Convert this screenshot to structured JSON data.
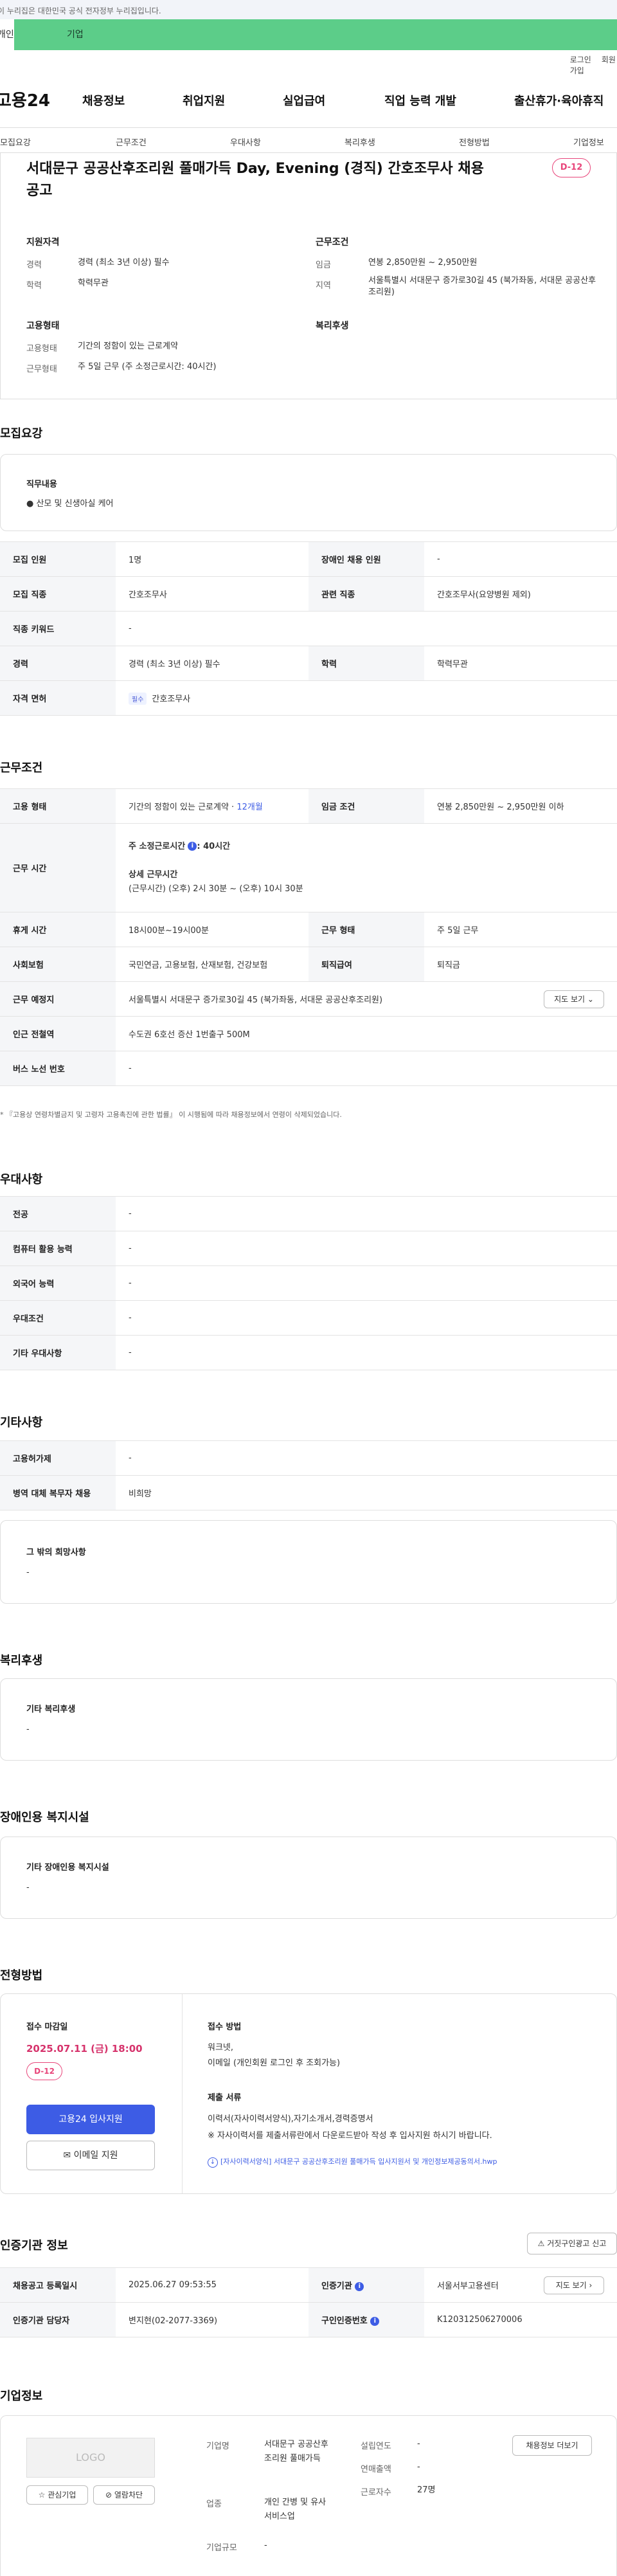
{
  "gov_banner": "이 누리집은 대한민국 공식 전자정부 누리집입니다.",
  "top_tabs": {
    "personal": "개인",
    "company": "기업"
  },
  "util": {
    "login": "로그인",
    "signup": "회원가입"
  },
  "gnb": {
    "logo": "고용24",
    "items": [
      "채용정보",
      "취업지원",
      "실업급여",
      "직업 능력 개발",
      "출산휴가·육아휴직"
    ]
  },
  "subnav": [
    "모집요강",
    "근무조건",
    "우대사항",
    "복리후생",
    "전형방법",
    "기업정보"
  ],
  "header": {
    "title": "서대문구 공공산후조리원 풀매가득 Day, Evening (경직) 간호조무사 채용 공고",
    "dday": "D-12",
    "qual": {
      "heading": "지원자격",
      "rows": [
        {
          "k": "경력",
          "v": "경력 (최소 3년 이상) 필수"
        },
        {
          "k": "학력",
          "v": "학력무관"
        }
      ]
    },
    "cond": {
      "heading": "근무조건",
      "rows": [
        {
          "k": "임금",
          "v": "연봉 2,850만원 ~ 2,950만원"
        },
        {
          "k": "지역",
          "v": "서울특별시 서대문구 증가로30길 45 (북가좌동, 서대문 공공산후조리원)"
        }
      ]
    },
    "emp": {
      "heading": "고용형태",
      "rows": [
        {
          "k": "고용형태",
          "v": "기간의 정함이 있는 근로계약"
        },
        {
          "k": "근무형태",
          "v": "주 5일 근무 (주 소정근로시간: 40시간)"
        }
      ]
    },
    "welfare": {
      "heading": "복리후생"
    }
  },
  "recruit": {
    "title": "모집요강",
    "duty_label": "직무내용",
    "duty": "● 산모 및 신생아실 케어",
    "rows": [
      {
        "k1": "모집 인원",
        "v1": "1명",
        "k2": "장애인 채용 인원",
        "v2": "-"
      },
      {
        "k1": "모집 직종",
        "v1": "간호조무사",
        "k2": "관련 직종",
        "v2": "간호조무사(요양병원 제외)"
      },
      {
        "k1": "직종 키워드",
        "v1": "-"
      },
      {
        "k1": "경력",
        "v1": "경력 (최소 3년 이상) 필수",
        "k2": "학력",
        "v2": "학력무관"
      },
      {
        "k1": "자격 면허",
        "badge": "필수",
        "v1": "간호조무사"
      }
    ]
  },
  "work": {
    "title": "근무조건",
    "emp_k": "고용 형태",
    "emp_v": "기간의 정함이 있는 근로계약 · ",
    "emp_v2": "12개월",
    "wage_k": "임금 조건",
    "wage_v": "연봉 2,850만원 ~ 2,950만원 이하",
    "time_k": "근무 시간",
    "time_week": "주 소정근로시간",
    "time_week_v": ": 40시간",
    "time_detail_h": "상세 근무시간",
    "time_detail": "(근무시간) (오후) 2시 30분 ~ (오후) 10시 30분",
    "rest_k": "휴게 시간",
    "rest_v": "18시00분~19시00분",
    "form_k": "근무 형태",
    "form_v": "주 5일 근무",
    "ins_k": "사회보험",
    "ins_v": "국민연금, 고용보험, 산재보험, 건강보험",
    "ret_k": "퇴직급여",
    "ret_v": "퇴직금",
    "place_k": "근무 예정지",
    "place_v": "서울특별시 서대문구 증가로30길 45 (북가좌동, 서대문 공공산후조리원)",
    "map_btn": "지도 보기",
    "subway_k": "인근 전철역",
    "subway_v": "수도권 6호선 증산 1번출구 500M",
    "bus_k": "버스 노선 번호",
    "bus_v": "-",
    "note": "* 『고용상 연령차별금지 및 고령자 고용촉진에 관한 법률』 이 시행됨에 따라 채용정보에서 연령이 삭제되었습니다."
  },
  "pref": {
    "title": "우대사항",
    "rows": [
      {
        "k": "전공",
        "v": "-"
      },
      {
        "k": "컴퓨터 활용 능력",
        "v": "-"
      },
      {
        "k": "외국어 능력",
        "v": "-"
      },
      {
        "k": "우대조건",
        "v": "-"
      },
      {
        "k": "기타 우대사항",
        "v": "-"
      }
    ]
  },
  "etc": {
    "title": "기타사항",
    "rows": [
      {
        "k": "고용허가제",
        "v": "-"
      },
      {
        "k": "병역 대체 복무자 채용",
        "v": "비희망"
      }
    ],
    "hope_h": "그 밖의 희망사항",
    "hope_v": "-"
  },
  "benefit": {
    "title": "복리후생",
    "h": "기타 복리후생",
    "v": "-"
  },
  "facility": {
    "title": "장애인용 복지시설",
    "h": "기타 장애인용 복지시설",
    "v": "-"
  },
  "process": {
    "title": "전형방법",
    "deadline_h": "접수 마감일",
    "deadline": "2025.07.11 (금) 18:00",
    "dday": "D-12",
    "apply_btn": "고용24 입사지원",
    "email_btn": "이메일 지원",
    "method_h": "접수 방법",
    "method": "워크넷,\n이메일 (개인회원 로그인 후 조회가능)",
    "docs_h": "제출 서류",
    "docs": "이력서(자사이력서양식),자기소개서,경력증명서\n※ 자사이력서를 제출서류란에서 다운로드받아 작성 후 입사지원 하시기 바랍니다.",
    "file": "[자사이력서양식] 서대문구 공공산후조리원 풀매가득 입사지원서 및 개인정보제공동의서.hwp"
  },
  "cert": {
    "title": "인증기관 정보",
    "report_btn": "거짓구인광고 신고",
    "reg_k": "채용공고 등록일시",
    "reg_v": "2025.06.27 09:53:55",
    "org_k": "인증기관",
    "org_v": "서울서부고용센터",
    "map_btn": "지도 보기",
    "mgr_k": "인증기관 담당자",
    "mgr_v": "변지현(02-2077-3369)",
    "id_k": "구인인증번호",
    "id_v": "K120312506270006"
  },
  "company": {
    "title": "기업정보",
    "logo": "LOGO",
    "fav_btn": "관심기업",
    "block_btn": "열람차단",
    "name_k": "기업명",
    "name_v": "서대문구 공공산후조리원 풀매가득",
    "ind_k": "업종",
    "ind_v": "개인 간병 및 유사 서비스업",
    "size_k": "기업규모",
    "size_v": "-",
    "est_k": "설립연도",
    "est_v": "-",
    "sales_k": "연매출액",
    "sales_v": "-",
    "emp_k": "근로자수",
    "emp_v": "27명",
    "more_btn": "채용정보 더보기"
  }
}
